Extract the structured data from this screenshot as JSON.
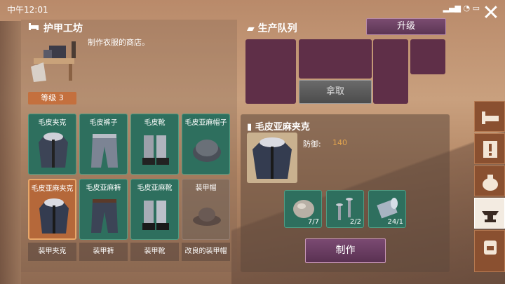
{
  "status": {
    "time": "中午12:01"
  },
  "shop": {
    "title": "护甲工坊",
    "description": "制作衣服的商店。",
    "level": "等级 3"
  },
  "items": [
    {
      "label": "毛皮夹克",
      "state": "normal",
      "icon": "fur-jacket-icon"
    },
    {
      "label": "毛皮裤子",
      "state": "normal",
      "icon": "fur-pants-icon"
    },
    {
      "label": "毛皮靴",
      "state": "normal",
      "icon": "fur-boots-icon"
    },
    {
      "label": "毛皮亚麻帽子",
      "state": "normal",
      "icon": "fur-hat-icon"
    },
    {
      "label": "毛皮亚麻夹克",
      "state": "selected",
      "icon": "linen-jacket-icon"
    },
    {
      "label": "毛皮亚麻裤",
      "state": "normal",
      "icon": "linen-pants-icon"
    },
    {
      "label": "毛皮亚麻靴",
      "state": "normal",
      "icon": "linen-boots-icon"
    },
    {
      "label": "装甲帽",
      "state": "locked",
      "icon": "armored-hat-icon"
    }
  ],
  "locked_items": [
    "装甲夹克",
    "装甲裤",
    "装甲靴",
    "改良的装甲帽"
  ],
  "queue": {
    "title": "生产队列",
    "upgrade_label": "升级",
    "take_label": "拿取"
  },
  "detail": {
    "name": "毛皮亚麻夹克",
    "defense_label": "防御:",
    "defense_value": "140",
    "materials": [
      {
        "icon": "stone-icon",
        "count": "7/7"
      },
      {
        "icon": "nails-icon",
        "count": "2/2"
      },
      {
        "icon": "fabric-roll-icon",
        "count": "24/1"
      }
    ],
    "craft_label": "制作"
  },
  "colors": {
    "accent": "#5c3554",
    "slot": "#5f2f48",
    "teal": "#2e6f5e",
    "orange": "#b5683a"
  }
}
